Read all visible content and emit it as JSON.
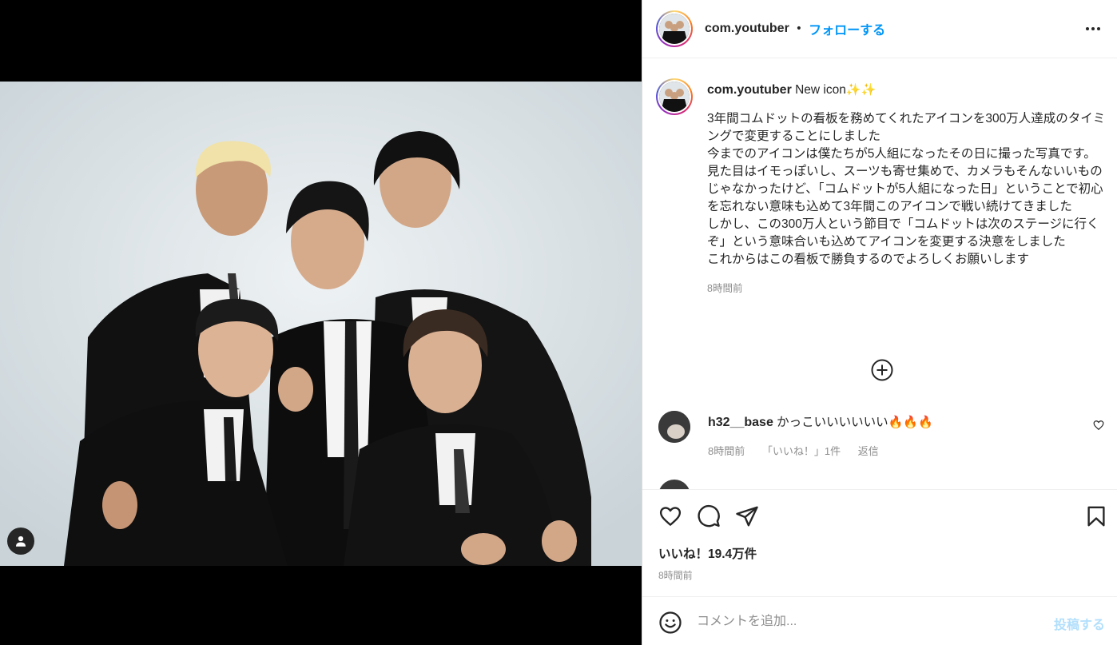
{
  "post": {
    "username": "com.youtuber",
    "separator": "•",
    "follow_label": "フォローする"
  },
  "caption": {
    "username": "com.youtuber",
    "headline": "New icon",
    "headline_emoji": "✨✨",
    "text": "3年間コムドットの看板を務めてくれたアイコンを300万人達成のタイミングで変更することにしました\n今までのアイコンは僕たちが5人組になったその日に撮った写真です。見た目はイモっぽいし、スーツも寄せ集めで、カメラもそんないいものじゃなかったけど、「コムドットが5人組になった日」ということで初心を忘れない意味も込めて3年間このアイコンで戦い続けてきました\nしかし、この300万人という節目で「コムドットは次のステージに行くぞ」という意味合いも込めてアイコンを変更する決意をしました\nこれからはこの看板で勝負するのでよろしくお願いします",
    "time": "8時間前"
  },
  "comments": [
    {
      "username": "h32__base",
      "text": "かっこいいいいいい",
      "emoji": "🔥🔥🔥",
      "time": "8時間前",
      "likes": "「いいね！」1件",
      "reply": "返信"
    }
  ],
  "actions": {
    "likes_label": "いいね！19.4万件",
    "time": "8時間前"
  },
  "add_comment": {
    "placeholder": "コメントを追加...",
    "post_label": "投稿する"
  },
  "icons": {
    "more": "more-options-icon",
    "load_more": "plus-circle-icon",
    "like": "heart-icon",
    "comment": "comment-bubble-icon",
    "share": "paper-plane-icon",
    "save": "bookmark-icon",
    "emoji": "smiley-icon",
    "tag": "user-tag-icon"
  },
  "colors": {
    "link_blue": "#0095f6",
    "post_disabled": "#b2dffc",
    "text_muted": "#8e8e8e"
  }
}
